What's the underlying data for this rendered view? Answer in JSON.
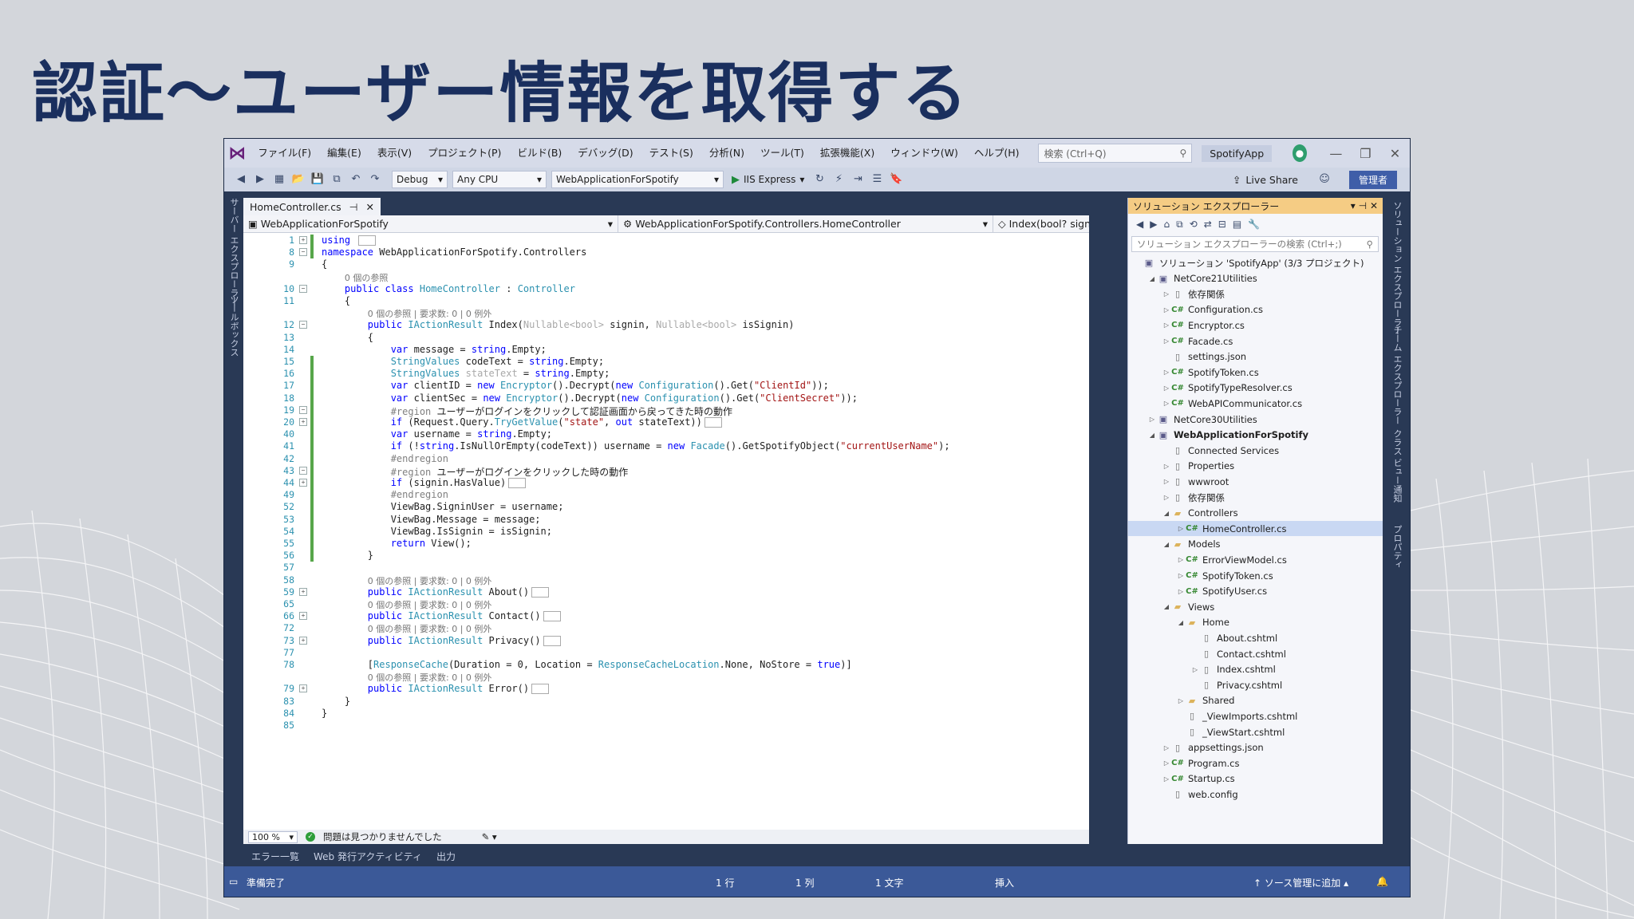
{
  "slide": {
    "title": "認証〜ユーザー情報を取得する"
  },
  "ide": {
    "menu": [
      "ファイル(F)",
      "編集(E)",
      "表示(V)",
      "プロジェクト(P)",
      "ビルド(B)",
      "デバッグ(D)",
      "テスト(S)",
      "分析(N)",
      "ツール(T)",
      "拡張機能(X)",
      "ウィンドウ(W)",
      "ヘルプ(H)"
    ],
    "search_placeholder": "検索 (Ctrl+Q)",
    "solution_badge": "SpotifyApp",
    "toolbar": {
      "config": "Debug",
      "platform": "Any CPU",
      "startup_project": "WebApplicationForSpotify",
      "run_label": "IIS Express",
      "live_share": "Live Share",
      "admin_badge": "管理者"
    },
    "left_tabs": [
      "サーバー エクスプローラー",
      "ツールボックス"
    ],
    "editor": {
      "tab_label": "HomeController.cs",
      "nav_project": "WebApplicationForSpotify",
      "nav_class": "WebApplicationForSpotify.Controllers.HomeController",
      "nav_member": "Index(bool? signin, bo",
      "zoom": "100 %",
      "issues": "問題は見つかりませんでした"
    },
    "code_lines": [
      {
        "n": "1",
        "html": "<span class='kw'>using</span> <span class='collapsed'></span>",
        "fold": "+"
      },
      {
        "n": "8",
        "html": "<span class='kw'>namespace</span> WebApplicationForSpotify.Controllers",
        "fold": "−"
      },
      {
        "n": "9",
        "html": "{"
      },
      {
        "n": "",
        "html": "    <span class='cm'>0 個の参照</span>"
      },
      {
        "n": "10",
        "html": "    <span class='kw'>public class</span> <span class='ty'>HomeController</span> : <span class='ty'>Controller</span>",
        "fold": "−"
      },
      {
        "n": "11",
        "html": "    {"
      },
      {
        "n": "",
        "html": "        <span class='cm'>0 個の参照 | 要求数: 0 | 0 例外</span>"
      },
      {
        "n": "12",
        "html": "        <span class='kw'>public</span> <span class='ty'>IActionResult</span> Index(<span class='dim'>Nullable&lt;bool&gt;</span> signin, <span class='dim'>Nullable&lt;bool&gt;</span> isSignin)",
        "fold": "−"
      },
      {
        "n": "13",
        "html": "        {"
      },
      {
        "n": "14",
        "html": "            <span class='kw'>var</span> message = <span class='kw'>string</span>.Empty;"
      },
      {
        "n": "15",
        "html": "            <span class='ty'>StringValues</span> codeText = <span class='kw'>string</span>.Empty;"
      },
      {
        "n": "16",
        "html": "            <span class='ty'>StringValues</span> <span class='dim'>stateText</span> = <span class='kw'>string</span>.Empty;"
      },
      {
        "n": "17",
        "html": "            <span class='kw'>var</span> clientID = <span class='kw'>new</span> <span class='ty'>Encryptor</span>().Decrypt(<span class='kw'>new</span> <span class='ty'>Configuration</span>().Get(<span class='str'>\"ClientId\"</span>));"
      },
      {
        "n": "18",
        "html": "            <span class='kw'>var</span> clientSec = <span class='kw'>new</span> <span class='ty'>Encryptor</span>().Decrypt(<span class='kw'>new</span> <span class='ty'>Configuration</span>().Get(<span class='str'>\"ClientSecret\"</span>));"
      },
      {
        "n": "19",
        "html": "            <span class='rg'>#region</span> <span class='cm' style='color:#1e1e1e;font-size:12px'>ユーザーがログインをクリックして認証画面から戻ってきた時の動作</span>",
        "fold": "−"
      },
      {
        "n": "20",
        "html": "            <span class='kw'>if</span> (Request.Query.<span class='ty'>TryGetValue</span>(<span class='str'>\"state\"</span>, <span class='kw'>out</span> stateText))<span class='collapsed'></span>",
        "fold": "+"
      },
      {
        "n": "40",
        "html": "            <span class='kw'>var</span> username = <span class='kw'>string</span>.Empty;"
      },
      {
        "n": "41",
        "html": "            <span class='kw'>if</span> (!<span class='kw'>string</span>.IsNullOrEmpty(codeText)) username = <span class='kw'>new</span> <span class='ty'>Facade</span>().GetSpotifyObject(<span class='str'>\"currentUserName\"</span>);"
      },
      {
        "n": "42",
        "html": "            <span class='rg'>#endregion</span>"
      },
      {
        "n": "43",
        "html": "            <span class='rg'>#region</span> <span class='cm' style='color:#1e1e1e;font-size:12px'>ユーザーがログインをクリックした時の動作</span>",
        "fold": "−"
      },
      {
        "n": "44",
        "html": "            <span class='kw'>if</span> (signin.HasValue)<span class='collapsed'></span>",
        "fold": "+"
      },
      {
        "n": "49",
        "html": "            <span class='rg'>#endregion</span>"
      },
      {
        "n": "52",
        "html": "            ViewBag.SigninUser = username;"
      },
      {
        "n": "53",
        "html": "            ViewBag.Message = message;"
      },
      {
        "n": "54",
        "html": "            ViewBag.IsSignin = isSignin;"
      },
      {
        "n": "55",
        "html": "            <span class='kw'>return</span> View();"
      },
      {
        "n": "56",
        "html": "        }"
      },
      {
        "n": "57",
        "html": ""
      },
      {
        "n": "58",
        "html": "        <span class='cm'>0 個の参照 | 要求数: 0 | 0 例外</span>"
      },
      {
        "n": "59",
        "html": "        <span class='kw'>public</span> <span class='ty'>IActionResult</span> About()<span class='collapsed'></span>",
        "fold": "+"
      },
      {
        "n": "65",
        "html": "        <span class='cm'>0 個の参照 | 要求数: 0 | 0 例外</span>"
      },
      {
        "n": "66",
        "html": "        <span class='kw'>public</span> <span class='ty'>IActionResult</span> Contact()<span class='collapsed'></span>",
        "fold": "+"
      },
      {
        "n": "72",
        "html": "        <span class='cm'>0 個の参照 | 要求数: 0 | 0 例外</span>"
      },
      {
        "n": "73",
        "html": "        <span class='kw'>public</span> <span class='ty'>IActionResult</span> Privacy()<span class='collapsed'></span>",
        "fold": "+"
      },
      {
        "n": "77",
        "html": ""
      },
      {
        "n": "78",
        "html": "        [<span class='ty'>ResponseCache</span>(Duration = 0, Location = <span class='ty'>ResponseCacheLocation</span>.None, NoStore = <span class='kw'>true</span>)]"
      },
      {
        "n": "",
        "html": "        <span class='cm'>0 個の参照 | 要求数: 0 | 0 例外</span>"
      },
      {
        "n": "79",
        "html": "        <span class='kw'>public</span> <span class='ty'>IActionResult</span> Error()<span class='collapsed'></span>",
        "fold": "+"
      },
      {
        "n": "83",
        "html": "    }"
      },
      {
        "n": "84",
        "html": "}"
      },
      {
        "n": "85",
        "html": ""
      }
    ],
    "solution_explorer": {
      "header": "ソリューション エクスプローラー",
      "search_placeholder": "ソリューション エクスプローラーの検索 (Ctrl+;)",
      "items": [
        {
          "label": "ソリューション 'SpotifyApp' (3/3 プロジェクト)",
          "depth": 0,
          "tw": "",
          "icon": "proj"
        },
        {
          "label": "NetCore21Utilities",
          "depth": 1,
          "tw": "◢",
          "icon": "proj"
        },
        {
          "label": "依存関係",
          "depth": 2,
          "tw": "▷",
          "icon": "file"
        },
        {
          "label": "Configuration.cs",
          "depth": 2,
          "tw": "▷",
          "icon": "cs"
        },
        {
          "label": "Encryptor.cs",
          "depth": 2,
          "tw": "▷",
          "icon": "cs"
        },
        {
          "label": "Facade.cs",
          "depth": 2,
          "tw": "▷",
          "icon": "cs"
        },
        {
          "label": "settings.json",
          "depth": 2,
          "tw": "",
          "icon": "file"
        },
        {
          "label": "SpotifyToken.cs",
          "depth": 2,
          "tw": "▷",
          "icon": "cs"
        },
        {
          "label": "SpotifyTypeResolver.cs",
          "depth": 2,
          "tw": "▷",
          "icon": "cs"
        },
        {
          "label": "WebAPICommunicator.cs",
          "depth": 2,
          "tw": "▷",
          "icon": "cs"
        },
        {
          "label": "NetCore30Utilities",
          "depth": 1,
          "tw": "▷",
          "icon": "proj"
        },
        {
          "label": "WebApplicationForSpotify",
          "depth": 1,
          "tw": "◢",
          "icon": "proj",
          "bold": true
        },
        {
          "label": "Connected Services",
          "depth": 2,
          "tw": "",
          "icon": "file"
        },
        {
          "label": "Properties",
          "depth": 2,
          "tw": "▷",
          "icon": "file"
        },
        {
          "label": "wwwroot",
          "depth": 2,
          "tw": "▷",
          "icon": "file"
        },
        {
          "label": "依存関係",
          "depth": 2,
          "tw": "▷",
          "icon": "file"
        },
        {
          "label": "Controllers",
          "depth": 2,
          "tw": "◢",
          "icon": "folder"
        },
        {
          "label": "HomeController.cs",
          "depth": 3,
          "tw": "▷",
          "icon": "cs",
          "selected": true
        },
        {
          "label": "Models",
          "depth": 2,
          "tw": "◢",
          "icon": "folder"
        },
        {
          "label": "ErrorViewModel.cs",
          "depth": 3,
          "tw": "▷",
          "icon": "cs"
        },
        {
          "label": "SpotifyToken.cs",
          "depth": 3,
          "tw": "▷",
          "icon": "cs"
        },
        {
          "label": "SpotifyUser.cs",
          "depth": 3,
          "tw": "▷",
          "icon": "cs"
        },
        {
          "label": "Views",
          "depth": 2,
          "tw": "◢",
          "icon": "folder"
        },
        {
          "label": "Home",
          "depth": 3,
          "tw": "◢",
          "icon": "folder"
        },
        {
          "label": "About.cshtml",
          "depth": 4,
          "tw": "",
          "icon": "file"
        },
        {
          "label": "Contact.cshtml",
          "depth": 4,
          "tw": "",
          "icon": "file"
        },
        {
          "label": "Index.cshtml",
          "depth": 4,
          "tw": "▷",
          "icon": "file"
        },
        {
          "label": "Privacy.cshtml",
          "depth": 4,
          "tw": "",
          "icon": "file"
        },
        {
          "label": "Shared",
          "depth": 3,
          "tw": "▷",
          "icon": "folder"
        },
        {
          "label": "_ViewImports.cshtml",
          "depth": 3,
          "tw": "",
          "icon": "file"
        },
        {
          "label": "_ViewStart.cshtml",
          "depth": 3,
          "tw": "",
          "icon": "file"
        },
        {
          "label": "appsettings.json",
          "depth": 2,
          "tw": "▷",
          "icon": "file"
        },
        {
          "label": "Program.cs",
          "depth": 2,
          "tw": "▷",
          "icon": "cs"
        },
        {
          "label": "Startup.cs",
          "depth": 2,
          "tw": "▷",
          "icon": "cs"
        },
        {
          "label": "web.config",
          "depth": 2,
          "tw": "",
          "icon": "file"
        }
      ]
    },
    "right_tabs": [
      "ソリューション エクスプローラー",
      "チーム エクスプローラー",
      "クラス ビュー",
      "通知",
      "プロパティ"
    ],
    "bottom_tabs": [
      "エラー一覧",
      "Web 発行アクティビティ",
      "出力"
    ],
    "status": {
      "ready": "準備完了",
      "line": "1 行",
      "col": "1 列",
      "char": "1 文字",
      "mode": "挿入",
      "source_control": "ソース管理に追加"
    }
  }
}
